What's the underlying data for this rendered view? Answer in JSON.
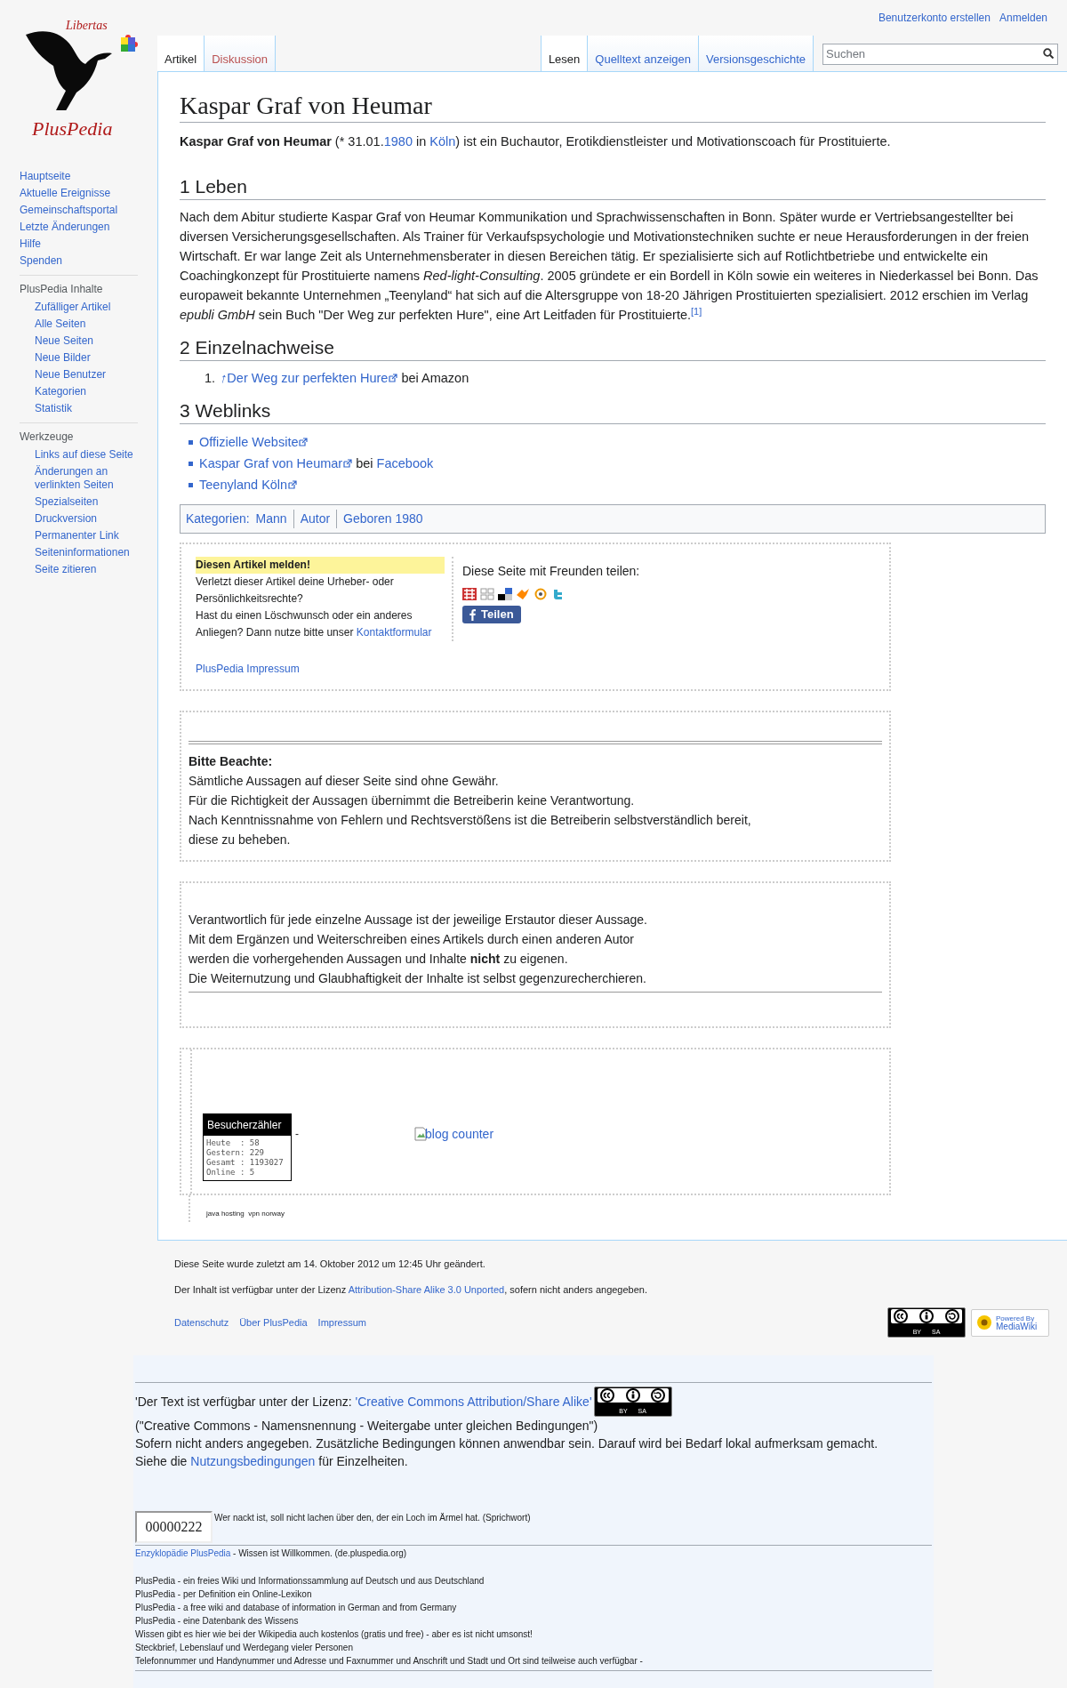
{
  "logo": {
    "top_text": "Libertas",
    "name": "PlusPedia"
  },
  "personal_links": [
    "Benutzerkonto erstellen",
    "Anmelden"
  ],
  "tabs_left": [
    {
      "label": "Artikel",
      "selected": true,
      "missing": false
    },
    {
      "label": "Diskussion",
      "selected": false,
      "missing": true
    }
  ],
  "tabs_right": [
    {
      "label": "Lesen",
      "selected": true
    },
    {
      "label": "Quelltext anzeigen",
      "selected": false
    },
    {
      "label": "Versionsgeschichte",
      "selected": false
    }
  ],
  "search": {
    "placeholder": "Suchen"
  },
  "sidebar": [
    {
      "items": [
        "Hauptseite",
        "Aktuelle Ereignisse",
        "Gemeinschaftsportal",
        "Letzte Änderungen",
        "Hilfe",
        "Spenden"
      ]
    },
    {
      "heading": "PlusPedia Inhalte",
      "items": [
        "Zufälliger Artikel",
        "Alle Seiten",
        "Neue Seiten",
        "Neue Bilder",
        "Neue Benutzer",
        "Kategorien",
        "Statistik"
      ]
    },
    {
      "heading": "Werkzeuge",
      "items": [
        "Links auf diese Seite",
        "Änderungen an verlinkten Seiten",
        "Spezialseiten",
        "Druckversion",
        "Permanenter Link",
        "Seiteninformationen",
        "Seite zitieren"
      ]
    }
  ],
  "title": "Kaspar Graf von Heumar",
  "intro": [
    {
      "t": "**Kaspar Graf von Heumar** (* 31.01."
    },
    {
      "t": "1980",
      "link": true
    },
    {
      "t": " in "
    },
    {
      "t": "Köln",
      "link": true
    },
    {
      "t": ") ist ein Buchautor, Erotikdienstleister und Motivationscoach für Prostituierte."
    }
  ],
  "sections": [
    {
      "heading": "1 Leben",
      "kind": "paragraph",
      "parts": [
        {
          "t": "Nach dem Abitur studierte Kaspar Graf von Heumar Kommunikation und Sprachwissenschaften in Bonn. Später wurde er Vertriebsangestellter bei diversen Versicherungsgesellschaften. Als Trainer für Verkaufspsychologie und Motivationstechniken suchte er neue Herausforderungen in der freien Wirtschaft. Er war lange Zeit als Unternehmensberater in diesen Bereichen tätig. Er spezialisierte sich auf Rotlichtbetriebe und entwickelte ein Coachingkonzept für Prostituierte namens *Red-light-Consulting*. 2005 gründete er ein Bordell in Köln sowie ein weiteres in Niederkassel bei Bonn. Das europaweit bekannte Unternehmen „Teenyland“ hat sich auf die Altersgruppe von 18-20 Jährigen Prostituierten spezialisiert. 2012 erschien im Verlag *epubli GmbH* sein Buch \"Der Weg zur perfekten Hure\", eine Art Leitfaden für Prostituierte."
        },
        {
          "t": "[1]",
          "link": true,
          "sup": true
        }
      ]
    },
    {
      "heading": "2 Einzelnachweise",
      "kind": "references",
      "items": [
        {
          "number": "1.",
          "parts": [
            {
              "t": "↑",
              "link": true,
              "italic": true
            },
            {
              "t": "Der Weg zur perfekten Hure",
              "link": true,
              "ext": true
            },
            {
              "t": " bei Amazon"
            }
          ]
        }
      ]
    },
    {
      "heading": "3 Weblinks",
      "kind": "bullets",
      "items": [
        {
          "parts": [
            {
              "t": "Offizielle Website",
              "link": true,
              "ext": true
            }
          ]
        },
        {
          "parts": [
            {
              "t": "Kaspar Graf von Heumar",
              "link": true,
              "ext": true
            },
            {
              "t": " bei "
            },
            {
              "t": "Facebook",
              "link": true
            }
          ]
        },
        {
          "parts": [
            {
              "t": "Teenyland Köln",
              "link": true,
              "ext": true
            }
          ]
        }
      ]
    }
  ],
  "categories": {
    "label": "Kategorien:",
    "items": [
      "Mann",
      "Autor",
      "Geboren 1980"
    ]
  },
  "report_box": {
    "heading": "Diesen Artikel melden!",
    "lines": [
      [
        {
          "t": "Verletzt dieser Artikel deine Urheber- oder"
        }
      ],
      [
        {
          "t": "Persönlichkeitsrechte?"
        }
      ],
      [
        {
          "t": "Hast du einen Löschwunsch oder ein anderes"
        }
      ],
      [
        {
          "t": "Anliegen? Dann nutze bitte unser "
        },
        {
          "t": "Kontaktformular",
          "link": true
        }
      ]
    ],
    "impressum": "PlusPedia Impressum"
  },
  "share": {
    "heading": "Diese Seite mit Freunden teilen:",
    "button": "Teilen"
  },
  "notice_1": {
    "heading": "Bitte Beachte:",
    "lines": [
      "Sämtliche Aussagen auf dieser Seite sind ohne Gewähr.",
      "Für die Richtigkeit der Aussagen übernimmt die Betreiberin keine Verantwortung.",
      "Nach Kenntnissnahme von Fehlern und Rechtsverstößens ist die Betreiberin selbstverständlich bereit,",
      "diese zu beheben."
    ]
  },
  "notice_2": {
    "lines": [
      "Verantwortlich für jede einzelne Aussage ist der jeweilige Erstautor dieser Aussage.",
      "Mit dem Ergänzen und Weiterschreiben eines Artikels durch einen anderen Autor",
      "werden die vorhergehenden Aussagen und Inhalte **nicht** zu eigenen.",
      "Die Weiternutzung und Glaubhaftigkeit der Inhalte ist selbst gegenzurecherchieren."
    ]
  },
  "visitor_counter": {
    "title": "Besucherzähler",
    "lines": [
      "Heute  : 58",
      "Gestern: 229",
      "Gesamt : 1193027",
      "Online : 5"
    ],
    "separator": "-",
    "blog_counter": "blog counter",
    "small_links": "java hosting  vpn norway"
  },
  "footer": {
    "last_modified": "Diese Seite wurde zuletzt am 14. Oktober 2012 um 12:45 Uhr geändert.",
    "license": [
      {
        "t": "Der Inhalt ist verfügbar unter der Lizenz "
      },
      {
        "t": "Attribution-Share Alike 3.0 Unported",
        "link": true
      },
      {
        "t": ", sofern nicht anders angegeben."
      }
    ],
    "links": [
      "Datenschutz",
      "Über PlusPedia",
      "Impressum"
    ],
    "cc_badge": [
      "BY",
      "SA"
    ],
    "mediawiki_badge": [
      "Powered By",
      "MediaWiki"
    ]
  },
  "bottom": {
    "license": [
      {
        "t": "'Der Text ist verfügbar unter der Lizenz: "
      },
      {
        "t": "'Creative Commons Attribution/Share Alike'",
        "link": true
      }
    ],
    "cc_badge": [
      "BY",
      "SA"
    ],
    "lines": [
      [
        {
          "t": "(\"Creative Commons - Namensnennung - Weitergabe unter gleichen Bedingungen\")"
        }
      ],
      [
        {
          "t": "Sofern nicht anders angegeben. Zusätzliche Bedingungen können anwendbar sein. Darauf wird bei Bedarf lokal aufmerksam gemacht."
        }
      ],
      [
        {
          "t": "Siehe die "
        },
        {
          "t": "Nutzungsbedingungen",
          "link": true
        },
        {
          "t": " für Einzelheiten."
        }
      ]
    ],
    "counter": "00000222",
    "quote": "Wer nackt ist, soll nicht lachen über den, der ein Loch im Ärmel hat. (Sprichwort)",
    "site_line": [
      {
        "t": "Enzyklopädie PlusPedia",
        "link": true
      },
      {
        "t": " - Wissen ist Willkommen. (de.pluspedia.org)"
      }
    ],
    "about": [
      "PlusPedia - ein freies Wiki und Informationssammlung auf Deutsch und aus Deutschland",
      "PlusPedia - per Definition ein Online-Lexikon",
      "PlusPedia - a free wiki and database of information in German and from Germany",
      "PlusPedia - eine Datenbank des Wissens",
      "Wissen gibt es hier wie bei der Wikipedia auch kostenlos (gratis und free) - aber es ist nicht umsonst!",
      "Steckbrief, Lebenslauf und Werdegang vieler Personen",
      "Telefonnummer und Handynummer und Adresse und Faxnummer und Anschrift und Stadt und Ort sind teilweise auch verfügbar -"
    ]
  }
}
